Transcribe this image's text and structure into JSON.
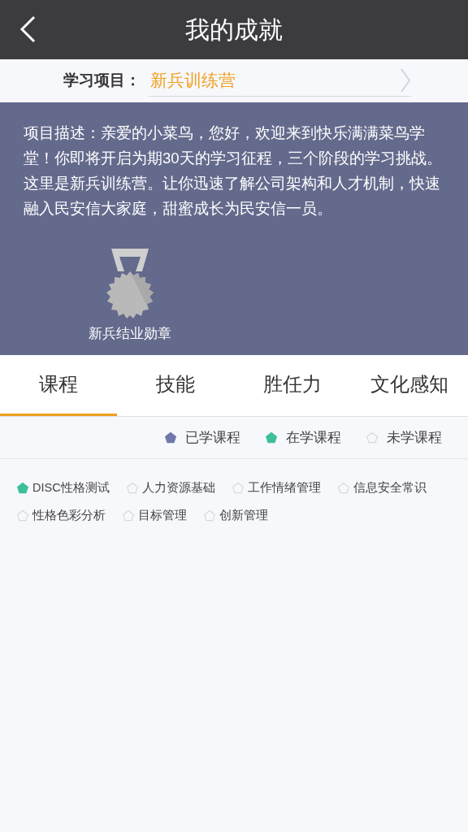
{
  "header": {
    "title": "我的成就"
  },
  "project": {
    "label": "学习项目：",
    "value": "新兵训练营"
  },
  "description": "项目描述：亲爱的小菜鸟，您好，欢迎来到快乐满满菜鸟学堂！你即将开启为期30天的学习征程，三个阶段的学习挑战。这里是新兵训练营。让你迅速了解公司架构和人才机制，快速融入民安信大家庭，甜蜜成长为民安信一员。",
  "badge": {
    "label": "新兵结业勋章"
  },
  "tabs": [
    {
      "label": "课程",
      "selected": true
    },
    {
      "label": "技能",
      "selected": false
    },
    {
      "label": "胜任力",
      "selected": false
    },
    {
      "label": "文化感知",
      "selected": false
    }
  ],
  "legend": [
    {
      "label": "已学课程",
      "kind": "done"
    },
    {
      "label": "在学课程",
      "kind": "learning"
    },
    {
      "label": "未学课程",
      "kind": "todo"
    }
  ],
  "courses": [
    {
      "label": "DISC性格测试",
      "kind": "learning"
    },
    {
      "label": "人力资源基础",
      "kind": "todo"
    },
    {
      "label": "工作情绪管理",
      "kind": "todo"
    },
    {
      "label": "信息安全常识",
      "kind": "todo"
    },
    {
      "label": "性格色彩分析",
      "kind": "todo"
    },
    {
      "label": "目标管理",
      "kind": "todo"
    },
    {
      "label": "创新管理",
      "kind": "todo"
    }
  ]
}
